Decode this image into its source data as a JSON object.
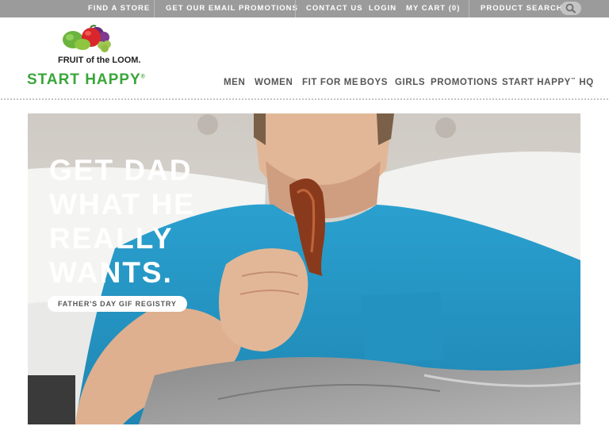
{
  "topbar": {
    "find_store": "FIND A STORE",
    "email_promos": "GET OUR EMAIL PROMOTIONS",
    "contact": "CONTACT US",
    "login": "LOGIN",
    "cart": "MY CART (0)",
    "search": "PRODUCT SEARCH"
  },
  "brand": {
    "name": "FRUIT of the LOOM.",
    "tagline": "START HAPPY",
    "tagline_mark": "®"
  },
  "nav": {
    "items": [
      "MEN",
      "WOMEN",
      "FIT FOR ME",
      "BOYS",
      "GIRLS",
      "PROMOTIONS",
      "START HAPPY"
    ],
    "hq_mark": "™",
    "hq_suffix": "HQ"
  },
  "hero": {
    "lines": [
      "GET DAD",
      "WHAT HE",
      "REALLY",
      "WANTS."
    ],
    "cta": "FATHER'S DAY GIF REGISTRY"
  },
  "colors": {
    "topbar": "#9b9b9b",
    "brand_green": "#3aa63a",
    "shirt": "#2b9dc9",
    "nav_text": "#555555"
  }
}
